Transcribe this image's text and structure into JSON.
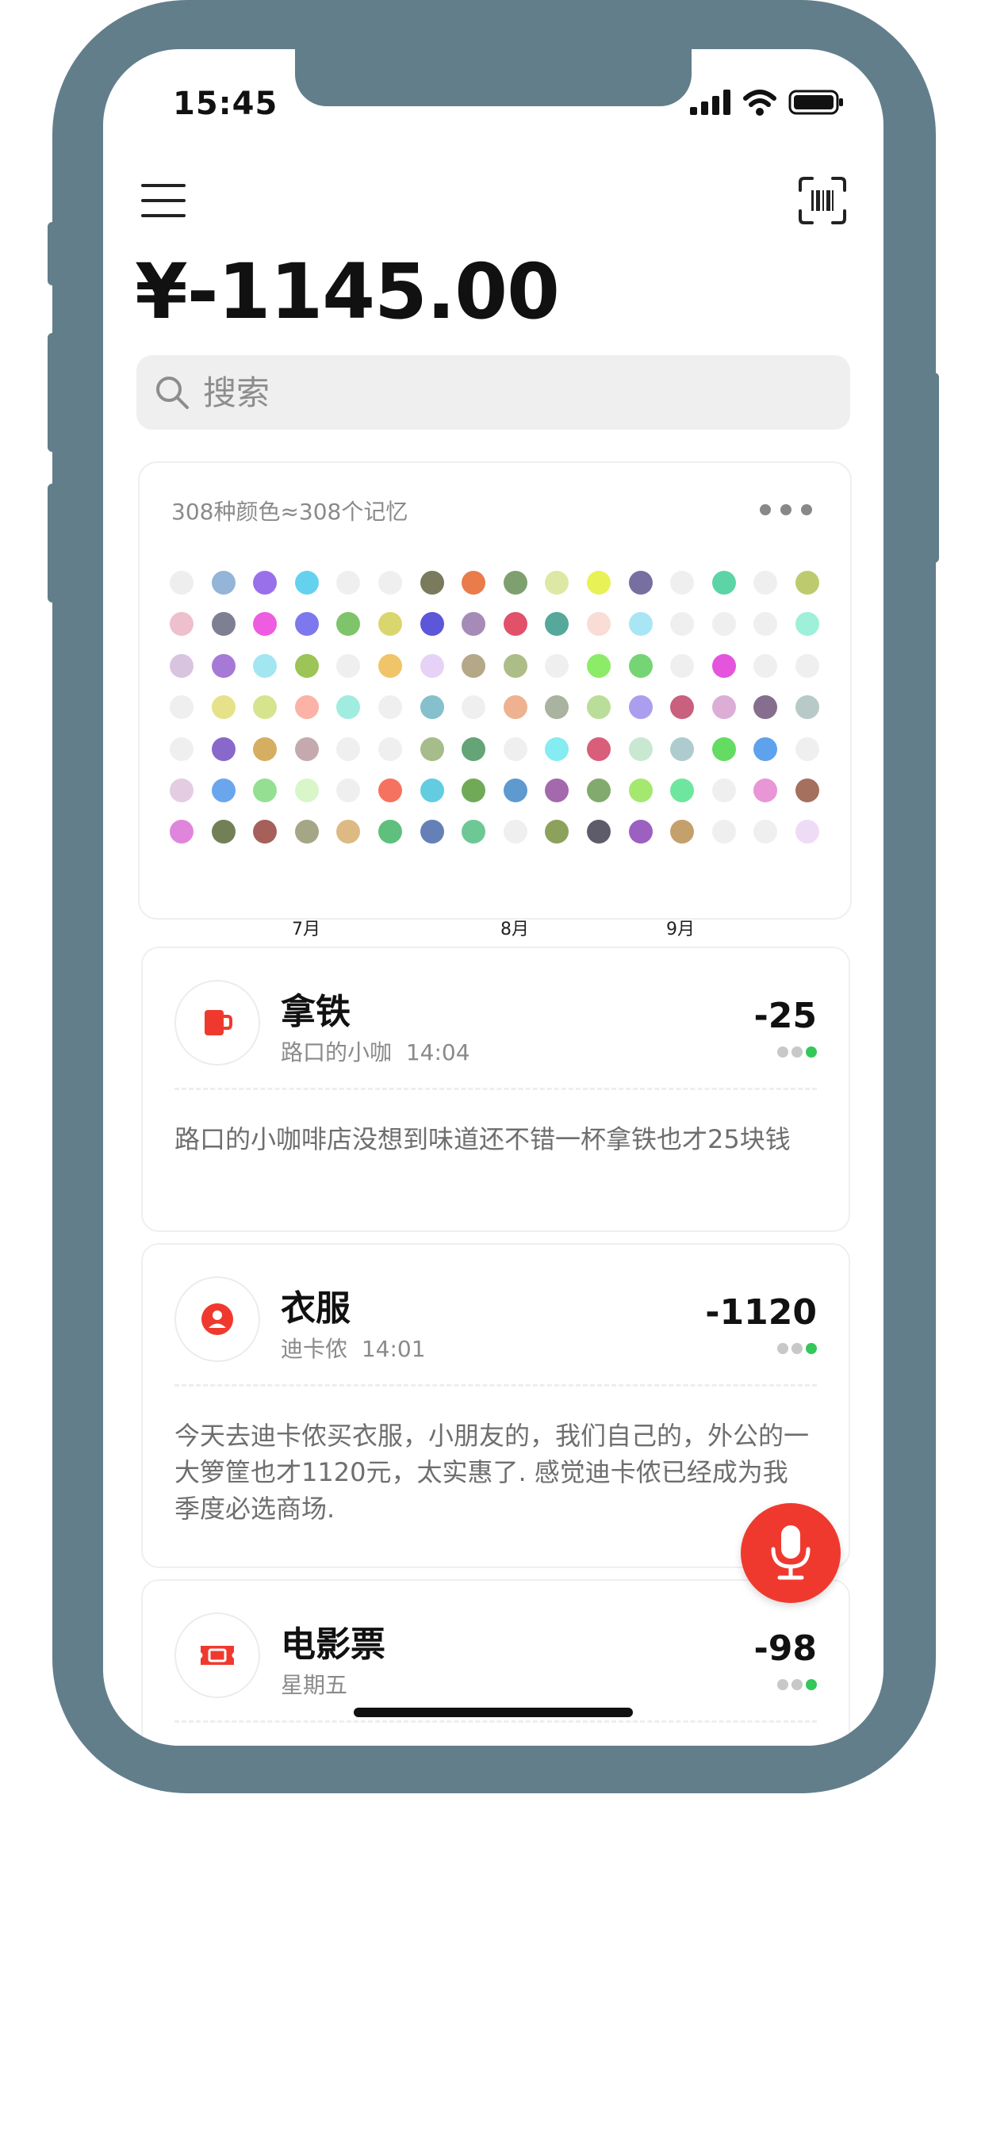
{
  "status_bar": {
    "time": "15:45"
  },
  "header": {
    "balance": "¥-1145.00"
  },
  "search": {
    "placeholder": "搜索"
  },
  "calendar": {
    "title": "308种颜色≈308个记忆",
    "months": [
      "7月",
      "8月",
      "9月"
    ],
    "rows": [
      [
        "#eeeeee",
        "#94b4d8",
        "#9a70ea",
        "#64d2ee",
        "#efefef",
        "#efefef",
        "#7a7a5c",
        "#ea7b4b",
        "#7ea06e",
        "#dde8a4",
        "#e8f256",
        "#776fa0",
        "#efefef",
        "#5dd4a6",
        "#efefef",
        "#bdcb6e"
      ],
      [
        "#eebfcc",
        "#7f7f94",
        "#ee5ce0",
        "#7e78ee",
        "#7ec46a",
        "#dad66e",
        "#5c56d8",
        "#a58bb6",
        "#e2506a",
        "#55a89a",
        "#fadcd6",
        "#a8e6f6",
        "#efefef",
        "#efefef",
        "#efefef",
        "#9ef0da"
      ],
      [
        "#d9c4e0",
        "#a779d6",
        "#a2e6f2",
        "#9cc456",
        "#efefef",
        "#f0c468",
        "#e6d2f6",
        "#b4a888",
        "#adbd88",
        "#efefef",
        "#8cec68",
        "#75d474",
        "#efefef",
        "#e454dc",
        "#efefef",
        "#efefef"
      ],
      [
        "#efefef",
        "#e6e28a",
        "#d6e48e",
        "#fcb2a6",
        "#a0ece0",
        "#efefef",
        "#85c0cc",
        "#efefef",
        "#eeb290",
        "#aab2a0",
        "#bade9a",
        "#ac9eee",
        "#c9607e",
        "#dcaed6",
        "#866e8e",
        "#b8cac8"
      ],
      [
        "#efefef",
        "#8868ca",
        "#d6ae62",
        "#c4aaae",
        "#efefef",
        "#efefef",
        "#a6bc8a",
        "#64a476",
        "#efefef",
        "#84ecf2",
        "#d85e7a",
        "#c8e8d2",
        "#aeccce",
        "#64dc62",
        "#5ea2ee",
        "#efefef"
      ],
      [
        "#e4cce2",
        "#6aa6ee",
        "#94e092",
        "#d8f6c8",
        "#efefef",
        "#f6725e",
        "#62cce0",
        "#70aa56",
        "#5e9ad0",
        "#a468ac",
        "#82aa6e",
        "#a4e870",
        "#6ee6a0",
        "#efefef",
        "#e896d6",
        "#a5705e"
      ],
      [
        "#df86dc",
        "#728058",
        "#a6605a",
        "#a4a686",
        "#ddba84",
        "#5ec07c",
        "#6480b6",
        "#6ec896",
        "#efefef",
        "#8ca25c",
        "#5e5c6a",
        "#9c60c0",
        "#c4a06c",
        "#efefef",
        "#efefef",
        "#eedcf6"
      ]
    ]
  },
  "entries": [
    {
      "icon": "coffee-cup-icon",
      "title": "拿铁",
      "place": "路口的小咖",
      "time": "14:04",
      "amount": "-25",
      "note": "路口的小咖啡店没想到味道还不错一杯拿铁也才25块钱"
    },
    {
      "icon": "person-icon",
      "title": "衣服",
      "place": "迪卡侬",
      "time": "14:01",
      "amount": "-1120",
      "note": "今天去迪卡侬买衣服，小朋友的，我们自己的，外公的一大箩筐也才1120元，太实惠了. 感觉迪卡侬已经成为我季度必选商场."
    },
    {
      "icon": "ticket-icon",
      "title": "电影票",
      "place": "星期五",
      "time": "",
      "amount": "-98",
      "note": ""
    }
  ],
  "colors": {
    "accent": "#f0392e",
    "frame": "#627e8b",
    "positive_dot": "#34c759",
    "neutral_dot": "#c8c8c8"
  }
}
